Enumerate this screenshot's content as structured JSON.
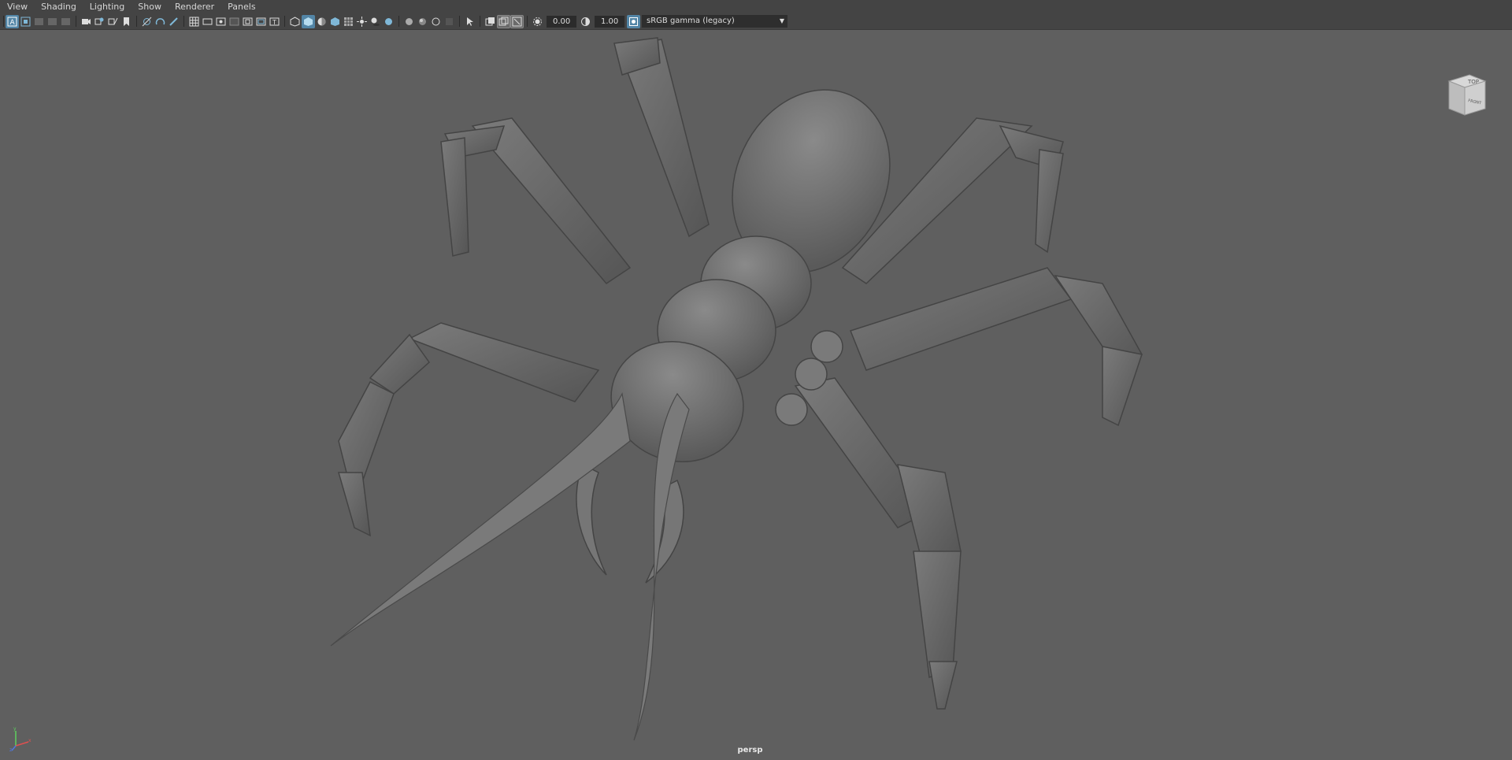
{
  "menu": {
    "items": [
      "View",
      "Shading",
      "Lighting",
      "Show",
      "Renderer",
      "Panels"
    ]
  },
  "toolbar": {
    "exposure_value": "0.00",
    "gamma_value": "1.00",
    "color_space": "sRGB gamma (legacy)"
  },
  "viewcube": {
    "top_label": "TOP",
    "front_label": "FRONT"
  },
  "viewport": {
    "camera_label": "persp",
    "background": "#5f5f5f"
  },
  "colors": {
    "menubar": "#444444",
    "accent": "#5285a6"
  }
}
